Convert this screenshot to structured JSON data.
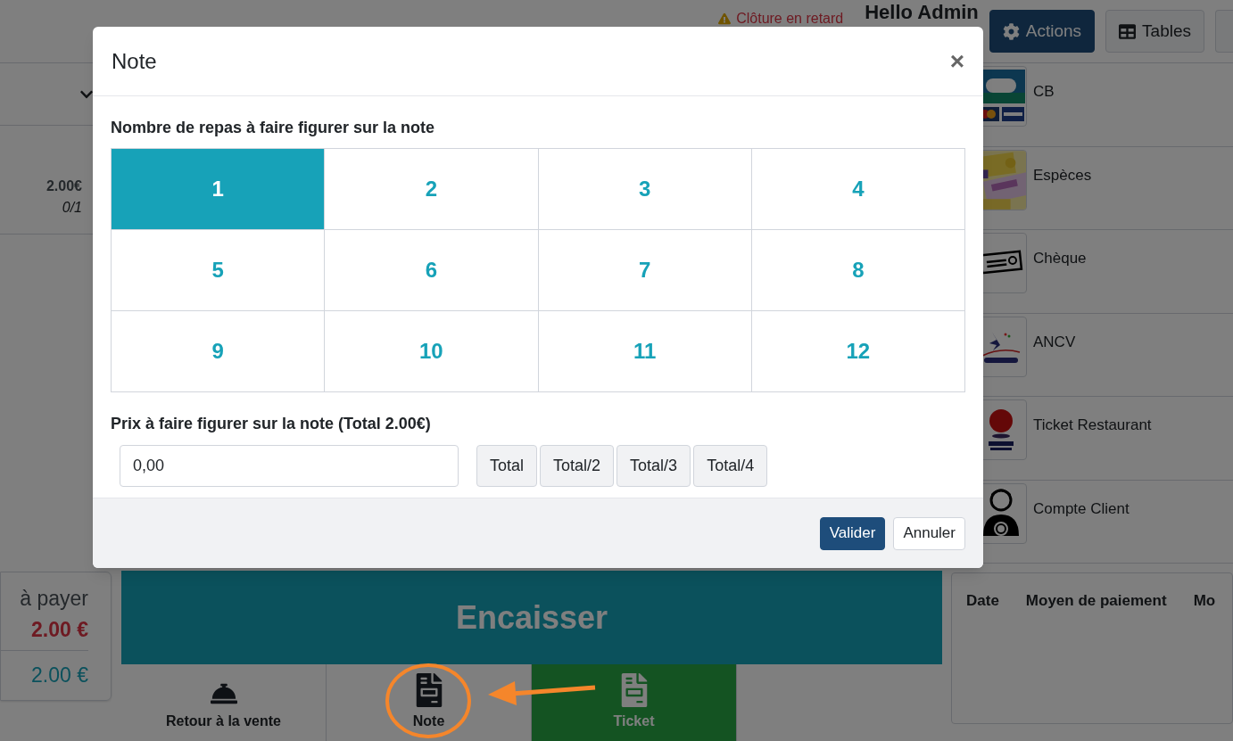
{
  "header": {
    "alert": "Clôture en retard",
    "user": "Hello Admin",
    "buttons": [
      {
        "label": "Actions",
        "kind": "primary"
      },
      {
        "label": "Tables",
        "kind": "default"
      }
    ]
  },
  "left": {
    "line": {
      "price": "2.00€",
      "quantity": "0/1"
    },
    "summary": {
      "label": "à payer",
      "due": "2.00 €",
      "paid": "2.00 €"
    }
  },
  "center": {
    "checkout_button": "Encaisser",
    "actions": [
      {
        "label": "Retour à la vente",
        "kind": "bell",
        "selected": false
      },
      {
        "label": "Note",
        "kind": "note",
        "selected": false
      },
      {
        "label": "Ticket",
        "kind": "ticket",
        "selected": true
      }
    ]
  },
  "payment_methods": [
    {
      "name": "CB",
      "kind": "card"
    },
    {
      "name": "Espèces",
      "kind": "cash"
    },
    {
      "name": "Chèque",
      "kind": "cheque"
    },
    {
      "name": "ANCV",
      "kind": "voucher"
    },
    {
      "name": "Ticket Restaurant",
      "kind": "meal"
    },
    {
      "name": "Compte Client",
      "kind": "account"
    }
  ],
  "payments_table": {
    "columns": [
      "Date",
      "Moyen de paiement",
      "Mo"
    ]
  },
  "modal": {
    "title": "Note",
    "close": "×",
    "count_label": "Nombre de repas à faire figurer sur la note",
    "counts": [
      {
        "label": "1",
        "selected": true
      },
      {
        "label": "2",
        "selected": false
      },
      {
        "label": "3",
        "selected": false
      },
      {
        "label": "4",
        "selected": false
      },
      {
        "label": "5",
        "selected": false
      },
      {
        "label": "6",
        "selected": false
      },
      {
        "label": "7",
        "selected": false
      },
      {
        "label": "8",
        "selected": false
      },
      {
        "label": "9",
        "selected": false
      },
      {
        "label": "10",
        "selected": false
      },
      {
        "label": "11",
        "selected": false
      },
      {
        "label": "12",
        "selected": false
      }
    ],
    "price_label": "Prix à faire figurer sur la note (Total 2.00€)",
    "price_value": "0,00",
    "price_buttons": [
      "Total",
      "Total/2",
      "Total/3",
      "Total/4"
    ],
    "buttons": [
      {
        "label": "Valider",
        "kind": "primary"
      },
      {
        "label": "Annuler",
        "kind": "secondary"
      }
    ]
  }
}
